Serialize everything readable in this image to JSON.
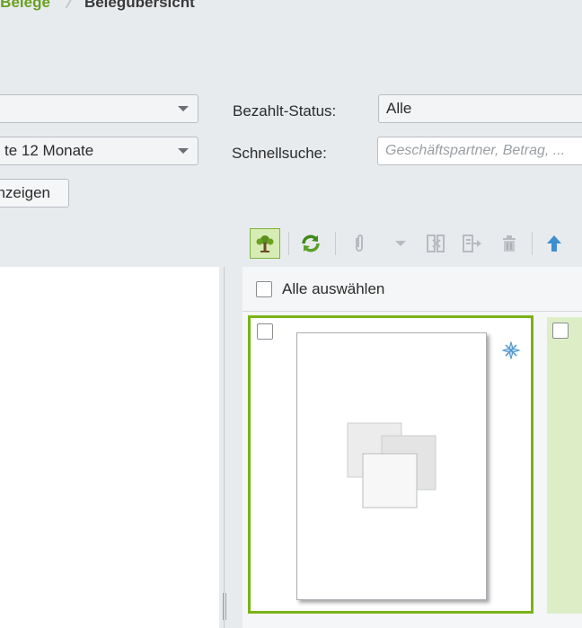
{
  "breadcrumb": {
    "parent": "e Belege",
    "current": "Belegübersicht"
  },
  "filters": {
    "select1_value": "",
    "period_value": "te 12 Monate",
    "paid_status_label": "Bezahlt-Status:",
    "paid_status_value": "Alle",
    "quicksearch_label": "Schnellsuche:",
    "quicksearch_placeholder": "Geschäftspartner, Betrag, ...",
    "show_button_label": "nzeigen"
  },
  "toolbar": {
    "icons": [
      "tree-icon",
      "refresh-icon",
      "attachment-icon",
      "dropdown-arrow-icon",
      "split-icon",
      "move-icon",
      "delete-icon",
      "upload-icon"
    ]
  },
  "list": {
    "select_all_label": "Alle auswählen"
  },
  "colors": {
    "accent": "#7ab317",
    "breadcrumb_link": "#6aa020",
    "card_selected_bg": "#ddeec6"
  }
}
